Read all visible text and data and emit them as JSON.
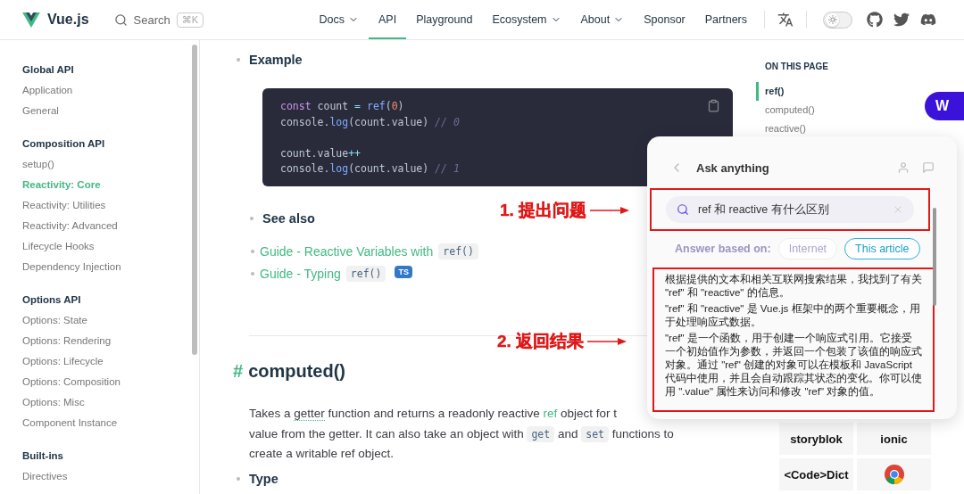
{
  "header": {
    "logo": "Vue.js",
    "search": {
      "placeholder": "Search",
      "shortcut": "⌘K"
    },
    "nav": [
      {
        "label": "Docs",
        "dropdown": true,
        "selected": false
      },
      {
        "label": "API",
        "dropdown": false,
        "selected": true
      },
      {
        "label": "Playground",
        "dropdown": false,
        "selected": false
      },
      {
        "label": "Ecosystem",
        "dropdown": true,
        "selected": false
      },
      {
        "label": "About",
        "dropdown": true,
        "selected": false
      },
      {
        "label": "Sponsor",
        "dropdown": false,
        "selected": false
      },
      {
        "label": "Partners",
        "dropdown": false,
        "selected": false
      }
    ],
    "dark_mode": false
  },
  "sidebar": {
    "groups": [
      {
        "title": "Global API",
        "items": [
          {
            "label": "Application",
            "selected": false
          },
          {
            "label": "General",
            "selected": false
          }
        ]
      },
      {
        "title": "Composition API",
        "items": [
          {
            "label": "setup()",
            "selected": false
          },
          {
            "label": "Reactivity: Core",
            "selected": true
          },
          {
            "label": "Reactivity: Utilities",
            "selected": false
          },
          {
            "label": "Reactivity: Advanced",
            "selected": false
          },
          {
            "label": "Lifecycle Hooks",
            "selected": false
          },
          {
            "label": "Dependency Injection",
            "selected": false
          }
        ]
      },
      {
        "title": "Options API",
        "items": [
          {
            "label": "Options: State",
            "selected": false
          },
          {
            "label": "Options: Rendering",
            "selected": false
          },
          {
            "label": "Options: Lifecycle",
            "selected": false
          },
          {
            "label": "Options: Composition",
            "selected": false
          },
          {
            "label": "Options: Misc",
            "selected": false
          },
          {
            "label": "Component Instance",
            "selected": false
          }
        ]
      },
      {
        "title": "Built-ins",
        "items": [
          {
            "label": "Directives",
            "selected": false
          }
        ]
      }
    ]
  },
  "content": {
    "example_title": "Example",
    "code": [
      {
        "gap_before": false,
        "tokens": [
          {
            "kind": "keyword",
            "text": "const"
          },
          {
            "kind": "plain",
            "text": " count "
          },
          {
            "kind": "operator",
            "text": "="
          },
          {
            "kind": "function",
            "text": " ref"
          },
          {
            "kind": "plain",
            "text": "("
          },
          {
            "kind": "number",
            "text": "0"
          },
          {
            "kind": "plain",
            "text": ")"
          }
        ]
      },
      {
        "gap_before": false,
        "tokens": [
          {
            "kind": "plain",
            "text": "console."
          },
          {
            "kind": "function",
            "text": "log"
          },
          {
            "kind": "plain",
            "text": "(count.value) "
          },
          {
            "kind": "comment",
            "text": "// 0"
          }
        ]
      },
      {
        "gap_before": true,
        "tokens": [
          {
            "kind": "plain",
            "text": "count.value"
          },
          {
            "kind": "operator",
            "text": "++"
          }
        ]
      },
      {
        "gap_before": false,
        "tokens": [
          {
            "kind": "plain",
            "text": "console."
          },
          {
            "kind": "function",
            "text": "log"
          },
          {
            "kind": "plain",
            "text": "(count.value) "
          },
          {
            "kind": "comment",
            "text": "// 1"
          }
        ]
      }
    ],
    "see_also_title": "See also",
    "see_also": [
      {
        "link": "Guide - Reactive Variables with",
        "code": "ref()"
      },
      {
        "link": "Guide - Typing",
        "code": "ref()",
        "badge": "TS"
      }
    ],
    "heading": "computed()",
    "heading_anchor": "#",
    "paragraph": [
      [
        {
          "kind": "text",
          "text": "Takes a "
        },
        {
          "kind": "term",
          "text": "getter"
        },
        {
          "kind": "text",
          "text": " function and returns a readonly reactive "
        },
        {
          "kind": "link",
          "text": "ref"
        },
        {
          "kind": "text",
          "text": " object for t"
        }
      ],
      [
        {
          "kind": "text",
          "text": "value from the getter. It can also take an object with "
        },
        {
          "kind": "code",
          "text": "get"
        },
        {
          "kind": "text",
          "text": " and "
        },
        {
          "kind": "code",
          "text": "set"
        },
        {
          "kind": "text",
          "text": " functions to"
        }
      ],
      [
        {
          "kind": "text",
          "text": "create a writable ref object."
        }
      ]
    ],
    "next_title": "Type"
  },
  "toc": {
    "title": "ON THIS PAGE",
    "items": [
      {
        "label": "ref()",
        "selected": true
      },
      {
        "label": "computed()",
        "selected": false
      },
      {
        "label": "reactive()",
        "selected": false
      }
    ]
  },
  "sponsors": [
    "storyblok",
    "ionic",
    "<Code>Dict"
  ],
  "assistant": {
    "launcher": "W",
    "title": "Ask anything",
    "query": "ref 和 reactive 有什么区别",
    "answer_label": "Answer based on:",
    "sources": [
      {
        "label": "Internet",
        "selected": false
      },
      {
        "label": "This article",
        "selected": true
      }
    ],
    "answer": [
      "根据提供的文本和相关互联网搜索结果，我找到了有关 \"ref\" 和 \"reactive\" 的信息。",
      "\"ref\" 和 \"reactive\" 是 Vue.js 框架中的两个重要概念，用于处理响应式数据。",
      "\"ref\" 是一个函数，用于创建一个响应式引用。它接受一个初始值作为参数，并返回一个包装了该值的响应式对象。通过 \"ref\" 创建的对象可以在模板和 JavaScript 代码中使用，并且会自动跟踪其状态的变化。你可以使用 \".value\" 属性来访问和修改 \"ref\" 对象的值。"
    ]
  },
  "annotations": [
    "1. 提出问题",
    "2. 返回结果"
  ]
}
